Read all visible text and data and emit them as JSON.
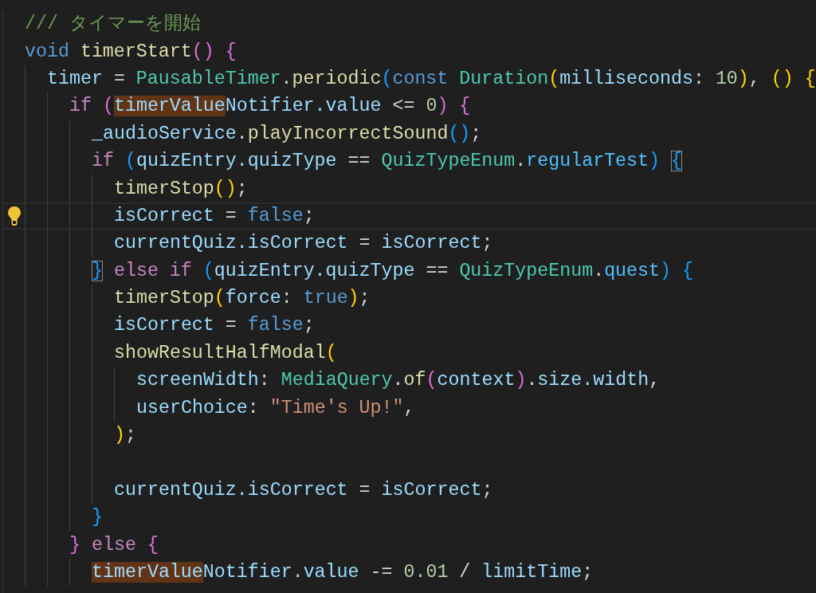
{
  "editor": {
    "lines": [
      {
        "current": false,
        "tokens": [
          {
            "kind": "comment",
            "text": "/// タイマーを開始"
          }
        ]
      },
      {
        "current": false,
        "tokens": [
          {
            "kind": "keyword",
            "text": "void "
          },
          {
            "kind": "function",
            "text": "timerStart"
          },
          {
            "kind": "bracket2",
            "text": "() "
          },
          {
            "kind": "bracket2",
            "text": "{"
          }
        ]
      },
      {
        "current": false,
        "tokens": [
          {
            "kind": "variable",
            "text": "  timer"
          },
          {
            "kind": "plain",
            "text": " = "
          },
          {
            "kind": "type",
            "text": "PausableTimer"
          },
          {
            "kind": "plain",
            "text": "."
          },
          {
            "kind": "function",
            "text": "periodic"
          },
          {
            "kind": "bracket3",
            "text": "("
          },
          {
            "kind": "keyword",
            "text": "const "
          },
          {
            "kind": "type",
            "text": "Duration"
          },
          {
            "kind": "bracket1",
            "text": "("
          },
          {
            "kind": "variable",
            "text": "milliseconds"
          },
          {
            "kind": "plain",
            "text": ": "
          },
          {
            "kind": "number",
            "text": "10"
          },
          {
            "kind": "bracket1",
            "text": ")"
          },
          {
            "kind": "plain",
            "text": ", "
          },
          {
            "kind": "bracket1",
            "text": "() "
          },
          {
            "kind": "bracket1",
            "text": "{"
          }
        ]
      },
      {
        "current": false,
        "tokens": [
          {
            "kind": "control",
            "text": "    if "
          },
          {
            "kind": "bracket2",
            "text": "("
          },
          {
            "kind": "highlight",
            "text": "timerValue"
          },
          {
            "kind": "variable",
            "text": "Notifier.value"
          },
          {
            "kind": "plain",
            "text": " <= "
          },
          {
            "kind": "number",
            "text": "0"
          },
          {
            "kind": "bracket2",
            "text": ") "
          },
          {
            "kind": "bracket2",
            "text": "{"
          }
        ]
      },
      {
        "current": false,
        "tokens": [
          {
            "kind": "variable",
            "text": "      _audioService"
          },
          {
            "kind": "plain",
            "text": "."
          },
          {
            "kind": "function",
            "text": "playIncorrectSound"
          },
          {
            "kind": "bracket3",
            "text": "()"
          },
          {
            "kind": "plain",
            "text": ";"
          }
        ]
      },
      {
        "current": false,
        "tokens": [
          {
            "kind": "control",
            "text": "      if "
          },
          {
            "kind": "bracket3",
            "text": "("
          },
          {
            "kind": "variable",
            "text": "quizEntry.quizType"
          },
          {
            "kind": "plain",
            "text": " == "
          },
          {
            "kind": "type",
            "text": "QuizTypeEnum"
          },
          {
            "kind": "plain",
            "text": "."
          },
          {
            "kind": "constant",
            "text": "regularTest"
          },
          {
            "kind": "bracket3",
            "text": ") "
          },
          {
            "kind": "matched3",
            "text": "{"
          }
        ]
      },
      {
        "current": false,
        "tokens": [
          {
            "kind": "function",
            "text": "        timerStop"
          },
          {
            "kind": "bracket1",
            "text": "()"
          },
          {
            "kind": "plain",
            "text": ";"
          }
        ]
      },
      {
        "current": true,
        "tokens": [
          {
            "kind": "variable",
            "text": "        isCorrect"
          },
          {
            "kind": "plain",
            "text": " = "
          },
          {
            "kind": "keyword",
            "text": "false"
          },
          {
            "kind": "plain",
            "text": ";"
          }
        ]
      },
      {
        "current": false,
        "tokens": [
          {
            "kind": "variable",
            "text": "        currentQuiz.isCorrect"
          },
          {
            "kind": "plain",
            "text": " = "
          },
          {
            "kind": "variable",
            "text": "isCorrect"
          },
          {
            "kind": "plain",
            "text": ";"
          }
        ]
      },
      {
        "current": false,
        "tokens": [
          {
            "kind": "matched3",
            "text": "      }"
          },
          {
            "kind": "control",
            "text": " else if "
          },
          {
            "kind": "bracket3",
            "text": "("
          },
          {
            "kind": "variable",
            "text": "quizEntry.quizType"
          },
          {
            "kind": "plain",
            "text": " == "
          },
          {
            "kind": "type",
            "text": "QuizTypeEnum"
          },
          {
            "kind": "plain",
            "text": "."
          },
          {
            "kind": "constant",
            "text": "quest"
          },
          {
            "kind": "bracket3",
            "text": ") "
          },
          {
            "kind": "bracket3",
            "text": "{"
          }
        ]
      },
      {
        "current": false,
        "tokens": [
          {
            "kind": "function",
            "text": "        timerStop"
          },
          {
            "kind": "bracket1",
            "text": "("
          },
          {
            "kind": "variable",
            "text": "force"
          },
          {
            "kind": "plain",
            "text": ": "
          },
          {
            "kind": "keyword",
            "text": "true"
          },
          {
            "kind": "bracket1",
            "text": ")"
          },
          {
            "kind": "plain",
            "text": ";"
          }
        ]
      },
      {
        "current": false,
        "tokens": [
          {
            "kind": "variable",
            "text": "        isCorrect"
          },
          {
            "kind": "plain",
            "text": " = "
          },
          {
            "kind": "keyword",
            "text": "false"
          },
          {
            "kind": "plain",
            "text": ";"
          }
        ]
      },
      {
        "current": false,
        "tokens": [
          {
            "kind": "function",
            "text": "        showResultHalfModal"
          },
          {
            "kind": "bracket1",
            "text": "("
          }
        ]
      },
      {
        "current": false,
        "tokens": [
          {
            "kind": "variable",
            "text": "          screenWidth"
          },
          {
            "kind": "plain",
            "text": ": "
          },
          {
            "kind": "type",
            "text": "MediaQuery"
          },
          {
            "kind": "plain",
            "text": "."
          },
          {
            "kind": "function",
            "text": "of"
          },
          {
            "kind": "bracket2",
            "text": "("
          },
          {
            "kind": "variable",
            "text": "context"
          },
          {
            "kind": "bracket2",
            "text": ")"
          },
          {
            "kind": "plain",
            "text": "."
          },
          {
            "kind": "variable",
            "text": "size.width"
          },
          {
            "kind": "plain",
            "text": ","
          }
        ]
      },
      {
        "current": false,
        "tokens": [
          {
            "kind": "variable",
            "text": "          userChoice"
          },
          {
            "kind": "plain",
            "text": ": "
          },
          {
            "kind": "string",
            "text": "\"Time's Up!\""
          },
          {
            "kind": "plain",
            "text": ","
          }
        ]
      },
      {
        "current": false,
        "tokens": [
          {
            "kind": "bracket1",
            "text": "        )"
          },
          {
            "kind": "plain",
            "text": ";"
          }
        ]
      },
      {
        "current": false
      },
      {
        "current": false,
        "tokens": [
          {
            "kind": "variable",
            "text": "        currentQuiz.isCorrect"
          },
          {
            "kind": "plain",
            "text": " = "
          },
          {
            "kind": "variable",
            "text": "isCorrect"
          },
          {
            "kind": "plain",
            "text": ";"
          }
        ]
      },
      {
        "current": false,
        "tokens": [
          {
            "kind": "bracket3",
            "text": "      }"
          }
        ]
      },
      {
        "current": false,
        "tokens": [
          {
            "kind": "bracket2",
            "text": "    } "
          },
          {
            "kind": "control",
            "text": "else "
          },
          {
            "kind": "bracket2",
            "text": "{"
          }
        ]
      },
      {
        "current": false,
        "tokens": [
          {
            "kind": "highlight",
            "text": "      timerValue"
          },
          {
            "kind": "variable",
            "text": "Notifier.value"
          },
          {
            "kind": "plain",
            "text": " -= "
          },
          {
            "kind": "number",
            "text": "0.01"
          },
          {
            "kind": "plain",
            "text": " / "
          },
          {
            "kind": "variable",
            "text": "limitTime"
          },
          {
            "kind": "plain",
            "text": ";"
          }
        ]
      }
    ]
  }
}
